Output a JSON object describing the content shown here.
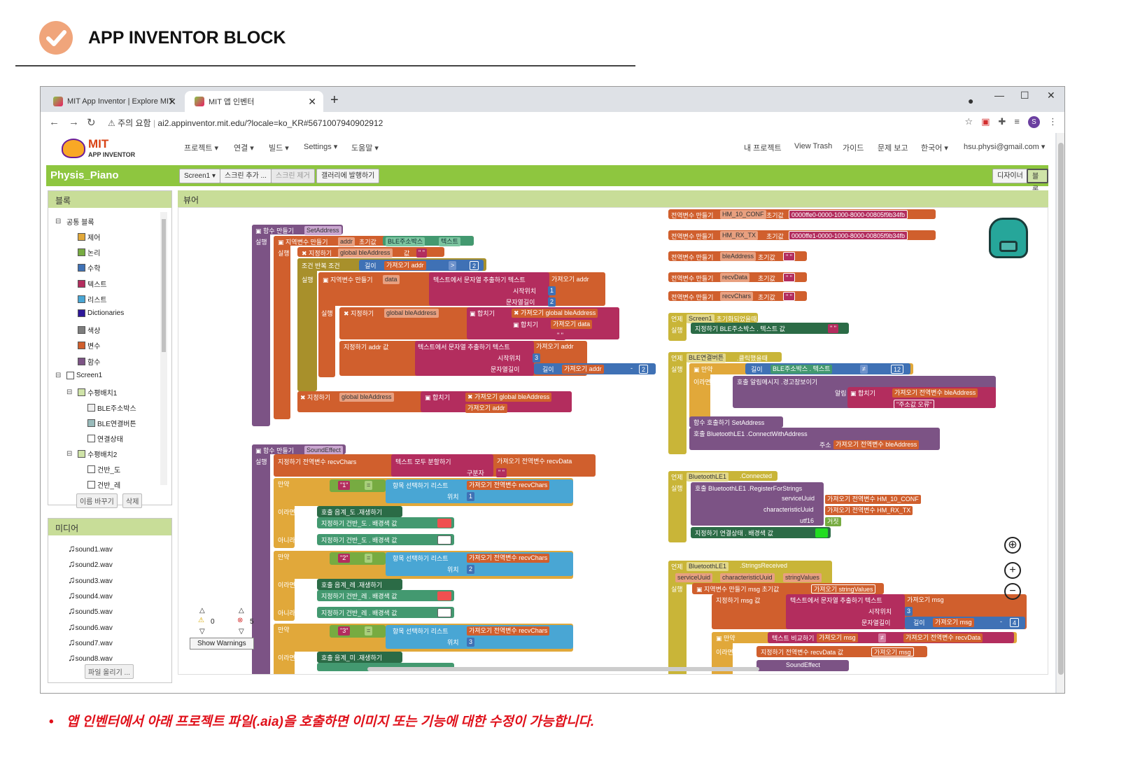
{
  "slide": {
    "title": "APP INVENTOR BLOCK",
    "note": "앱 인벤터에서 아래 프로젝트 파일(.aia)을 호출하면 이미지 또는 기능에 대한 수정이 가능합니다."
  },
  "browser": {
    "tabs": [
      {
        "label": "MIT App Inventor | Explore MIT"
      },
      {
        "label": "MIT 앱 인벤터"
      }
    ],
    "security_label": "주의 요함",
    "url": "ai2.appinventor.mit.edu/?locale=ko_KR#5671007940902912",
    "profile_initial": "S"
  },
  "app": {
    "logo_main": "MIT",
    "logo_sub": "APP INVENTOR",
    "menu": [
      "프로젝트 ▾",
      "연결 ▾",
      "빌드 ▾",
      "Settings ▾",
      "도움말 ▾"
    ],
    "right_menu": [
      "내 프로젝트",
      "View Trash",
      "가이드",
      "문제 보고",
      "한국어 ▾",
      "hsu.physi@gmail.com ▾"
    ],
    "project_name": "Physis_Piano",
    "project_buttons": [
      "Screen1 ▾",
      "스크린 추가 ...",
      "스크린 제거",
      "갤러리에 발행하기"
    ],
    "view_buttons": [
      "디자이너",
      "블록"
    ]
  },
  "blocks_panel": {
    "header": "블록",
    "builtin_label": "공통 블록",
    "builtin": [
      {
        "label": "제어",
        "color": "#e1a83a"
      },
      {
        "label": "논리",
        "color": "#77ab41"
      },
      {
        "label": "수학",
        "color": "#3f71b5"
      },
      {
        "label": "텍스트",
        "color": "#b32d5e"
      },
      {
        "label": "리스트",
        "color": "#49a6d4"
      },
      {
        "label": "Dictionaries",
        "color": "#2d1799"
      },
      {
        "label": "색상",
        "color": "#7d7d7d"
      },
      {
        "label": "변수",
        "color": "#d05f2d"
      },
      {
        "label": "함수",
        "color": "#7c5385"
      }
    ],
    "screen": "Screen1",
    "arrangement1": "수평배치1",
    "arrangement1_children": [
      "BLE주소박스",
      "BLE연결버튼",
      "연결상태"
    ],
    "arrangement2": "수평배치2",
    "arrangement2_children": [
      "건반_도",
      "건반_레"
    ],
    "rename_button": "이름 바꾸기",
    "delete_button": "삭제"
  },
  "media_panel": {
    "header": "미디어",
    "files": [
      "sound1.wav",
      "sound2.wav",
      "sound3.wav",
      "sound4.wav",
      "sound5.wav",
      "sound6.wav",
      "sound7.wav",
      "sound8.wav"
    ],
    "upload_button": "파일 올리기 ..."
  },
  "viewer": {
    "header": "뷰어",
    "warning_count": "0",
    "error_count": "5",
    "show_warnings": "Show Warnings"
  },
  "blocks": {
    "set_address": {
      "def": "함수 만들기",
      "name": "SetAddress",
      "do": "실행",
      "local_var": "지역변수 만들기",
      "local_addr": "addr",
      "init": "초기값",
      "ble_box": "BLE주소박스",
      "text_prop": "텍스트",
      "do2": "실행",
      "set": "지정하기",
      "global_ble": "global bleAddress",
      "val": "값",
      "empty": "\" \"",
      "while": "조건 반복 조건",
      "length": "길이",
      "get": "가져오기",
      "gt": ">",
      "two": "2",
      "local_data": "data",
      "segment": "텍스트에서 문자열 추출하기 텍스트",
      "start": "시작위치",
      "one": "1",
      "len_label": "문자열길이",
      "join": "합치기",
      "three": "3",
      "minus": "-"
    },
    "sound_effect": {
      "def": "함수 만들기",
      "name": "SoundEffect",
      "do": "실행",
      "set_recv": "지정하기 전역변수 recvChars",
      "split": "텍스트 모두 분할하기",
      "get_recvdata": "가져오기 전역변수 recvData",
      "sep": "구분자",
      "if": "만약",
      "then": "이라면 실행",
      "else": "아니라면",
      "select": "항목 선택하기 리스트",
      "index": "위치",
      "get_recvchars": "가져오기 전역변수 recvChars",
      "call_do": "호출 음계_도 .재생하기",
      "call_re": "호출 음계_레 .재생하기",
      "call_mi": "호출 음계_미 .재생하기",
      "set_do": "지정하기 건반_도 . 배경색 값",
      "set_re": "지정하기 건반_레 . 배경색 값",
      "k1": "\"1\"",
      "k2": "\"2\"",
      "k3": "\"3\"",
      "eq": "=",
      "i1": "1",
      "i2": "2",
      "i3": "3"
    },
    "globals": [
      {
        "label": "전역변수 만들기",
        "name": "HM_10_CONF",
        "init": "초기값",
        "value": "0000ffe0-0000-1000-8000-00805f9b34fb"
      },
      {
        "label": "전역변수 만들기",
        "name": "HM_RX_TX",
        "init": "초기값",
        "value": "0000ffe1-0000-1000-8000-00805f9b34fb"
      },
      {
        "label": "전역변수 만들기",
        "name": "bleAddress",
        "init": "초기값",
        "value": "\" \""
      },
      {
        "label": "전역변수 만들기",
        "name": "recvData",
        "init": "초기값",
        "value": "\" \""
      },
      {
        "label": "전역변수 만들기",
        "name": "recvChars",
        "init": "초기값",
        "value": "\" \""
      }
    ],
    "screen_init": {
      "when": "언제",
      "comp": "Screen1",
      "event": ".초기화되었을때",
      "do": "실행",
      "set": "지정하기 BLE주소박스 . 텍스트 값"
    },
    "ble_click": {
      "when": "언제",
      "comp": "BLE연결버튼",
      "event": ".클릭했을때",
      "do": "실행",
      "if": "만약",
      "length": "길이",
      "box": "BLE주소박스 . 텍스트",
      "neq": "≠",
      "n": "12",
      "then": "이라면 실행",
      "call_alert": "호출 알림메시지 .경고창보이기",
      "alert": "알림",
      "join": "합치기",
      "get_ble": "가져오기 전역변수 bleAddress",
      "err": "\"주소값 오류\"",
      "call_set": "함수 호출하기 SetAddress",
      "call_connect": "호출 BluetoothLE1 .ConnectWithAddress",
      "addr": "주소",
      "get_ble2": "가져오기 전역변수 bleAddress"
    },
    "ble_connected": {
      "when": "언제",
      "comp": "BluetoothLE1",
      "event": ".Connected",
      "do": "실행",
      "call": "호출 BluetoothLE1 .RegisterForStrings",
      "svc": "serviceUuid",
      "chr": "characteristicUuid",
      "utf": "utf16",
      "get_conf": "가져오기 전역변수 HM_10_CONF",
      "get_rx": "가져오기 전역변수 HM_RX_TX",
      "false": "거짓",
      "set_status": "지정하기 연결상태 . 배경색 값"
    },
    "ble_strings": {
      "when": "언제",
      "comp": "BluetoothLE1",
      "event": ".StringsReceived",
      "p1": "serviceUuid",
      "p2": "characteristicUuid",
      "p3": "stringValues",
      "do": "실행",
      "local": "지역변수 만들기 msg 초기값",
      "get_sv": "가져오기 stringValues",
      "do2": "실행",
      "set_msg": "지정하기 msg 값",
      "segment": "텍스트에서 문자열 추출하기 텍스트",
      "get_msg": "가져오기 msg",
      "start": "시작위치",
      "len_label": "문자열길이",
      "three": "3",
      "len": "길이",
      "minus": "-",
      "four": "4",
      "if": "만약",
      "compare": "텍스트 비교하기",
      "neq": "≠",
      "get_recvdata": "가져오기 전역변수 recvData",
      "then": "이라면 실행",
      "set_recvdata": "지정하기 전역변수 recvData 값",
      "call_sound": "SoundEffect"
    }
  },
  "colors": {
    "procedure": "#7c5385",
    "variable": "#d05f2d",
    "text": "#b32d5e",
    "control": "#e1a83a",
    "control_dark": "#a8902b",
    "math": "#3f71b5",
    "list": "#49a6d4",
    "logic": "#77ab41",
    "component": "#439970",
    "component_dark": "#2b6b46",
    "event": "#c9b538",
    "red_key": "#f05050",
    "green_status": "#22dd22"
  }
}
